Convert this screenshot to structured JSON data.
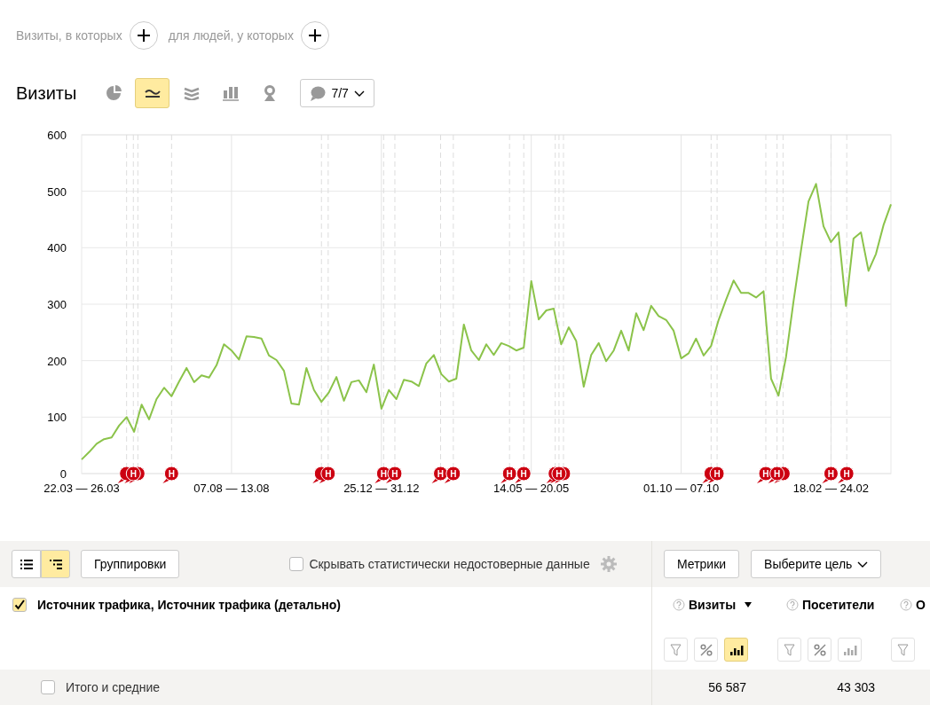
{
  "filter_bar": {
    "segments": [
      {
        "label": "Визиты, в которых"
      },
      {
        "label": "для людей, у которых"
      }
    ]
  },
  "chart_panel": {
    "title": "Визиты",
    "chart_types": [
      {
        "kind": "pie",
        "selected": false
      },
      {
        "kind": "line",
        "selected": true
      },
      {
        "kind": "area",
        "selected": false
      },
      {
        "kind": "bars",
        "selected": false
      },
      {
        "kind": "map",
        "selected": false
      }
    ],
    "notes_button": {
      "label": "7/7"
    },
    "chart_data": {
      "type": "line",
      "categories": [
        "22.03 — 26.03",
        null,
        null,
        null,
        null,
        null,
        null,
        null,
        null,
        null,
        null,
        null,
        null,
        null,
        null,
        null,
        null,
        null,
        null,
        null,
        "07.08 — 13.08",
        null,
        null,
        null,
        null,
        null,
        null,
        null,
        null,
        null,
        null,
        null,
        null,
        null,
        null,
        null,
        null,
        null,
        null,
        null,
        "25.12 — 31.12",
        null,
        null,
        null,
        null,
        null,
        null,
        null,
        null,
        null,
        null,
        null,
        null,
        null,
        null,
        null,
        null,
        null,
        null,
        null,
        "14.05 — 20.05",
        null,
        null,
        null,
        null,
        null,
        null,
        null,
        null,
        null,
        null,
        null,
        null,
        null,
        null,
        null,
        null,
        null,
        null,
        null,
        "01.10 — 07.10",
        null,
        null,
        null,
        null,
        null,
        null,
        null,
        null,
        null,
        null,
        null,
        null,
        null,
        null,
        null,
        null,
        null,
        null,
        null,
        "18.02 — 24.02",
        null,
        null,
        null,
        null,
        null,
        null,
        null,
        null
      ],
      "series": [
        {
          "color": "#8bc34a",
          "values": [
            25,
            38,
            53,
            61,
            64,
            85,
            100,
            74,
            122,
            96,
            132,
            152,
            137,
            163,
            187,
            162,
            174,
            170,
            192,
            229,
            218,
            202,
            243,
            242,
            239,
            209,
            201,
            182,
            124,
            122,
            187,
            148,
            127,
            144,
            171,
            129,
            162,
            165,
            144,
            193,
            115,
            148,
            132,
            166,
            163,
            155,
            195,
            210,
            176,
            163,
            168,
            264,
            218,
            201,
            229,
            210,
            231,
            226,
            218,
            223,
            341,
            273,
            289,
            292,
            229,
            259,
            235,
            154,
            210,
            231,
            199,
            218,
            253,
            218,
            284,
            254,
            297,
            279,
            272,
            253,
            204,
            213,
            239,
            209,
            226,
            272,
            308,
            342,
            320,
            320,
            312,
            323,
            168,
            138,
            207,
            305,
            396,
            482,
            513,
            438,
            410,
            427,
            297,
            416,
            427,
            359,
            389,
            440,
            477
          ]
        }
      ],
      "ylim": [
        0,
        600
      ],
      "yticks": [
        0,
        100,
        200,
        300,
        400,
        500,
        600
      ],
      "grid": true
    },
    "note_markers": [
      {
        "text": "Н"
      },
      {
        "text": "Н"
      },
      {
        "text": "Н"
      },
      {
        "text": "Н"
      },
      {
        "text": "Н"
      },
      {
        "text": "Н"
      },
      {
        "text": "Н"
      },
      {
        "text": "Н"
      },
      {
        "text": "Н"
      },
      {
        "text": "Н"
      },
      {
        "text": "Н"
      },
      {
        "text": "Н"
      },
      {
        "text": "Н"
      },
      {
        "text": "Н"
      },
      {
        "text": "Н"
      }
    ]
  },
  "table": {
    "view_toggle": [
      {
        "kind": "list",
        "selected": false
      },
      {
        "kind": "tree",
        "selected": true
      }
    ],
    "groupings_button": "Группировки",
    "hide_unreliable": {
      "label": "Скрывать статистически недостоверные данные",
      "checked": false
    },
    "metrics_button": "Метрики",
    "goal_select": "Выберите цель",
    "dimension_header": {
      "label": "Источник трафика, Источник трафика (детально)",
      "checked": true
    },
    "columns": [
      {
        "kind": "full",
        "label": "Визиты",
        "sorted": true,
        "chart_selected": true
      },
      {
        "kind": "full",
        "label": "Посетители",
        "sorted": false,
        "chart_selected": false
      },
      {
        "kind": "cut",
        "label": "О"
      }
    ],
    "totals_row": {
      "label": "Итого и средние",
      "checked": false,
      "values": [
        "56 587",
        "43 303"
      ]
    }
  }
}
